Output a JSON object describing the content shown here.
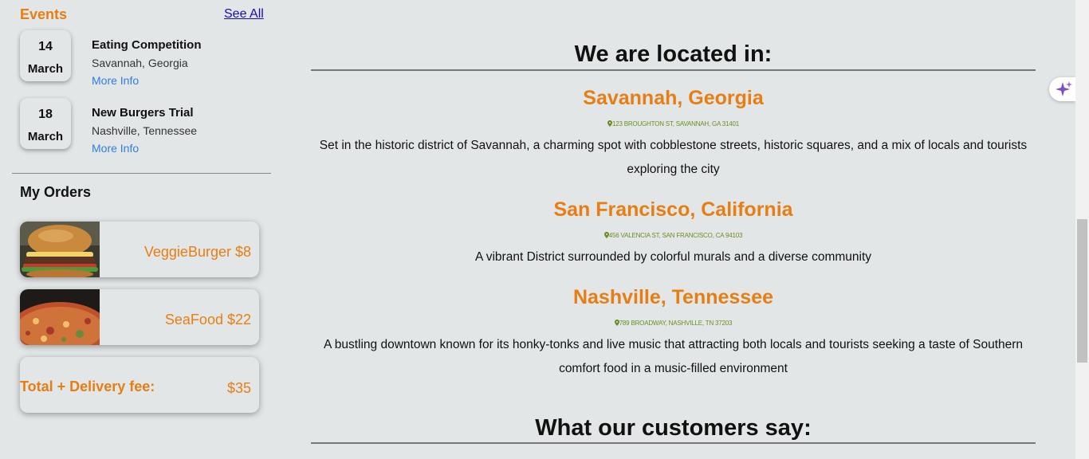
{
  "events": {
    "title": "Events",
    "see_all": "See All",
    "items": [
      {
        "day": "14",
        "month": "March",
        "name": "Eating Competition",
        "place": "Savannah, Georgia",
        "more": "More Info"
      },
      {
        "day": "18",
        "month": "March",
        "name": "New Burgers Trial",
        "place": "Nashville, Tennessee",
        "more": "More Info"
      }
    ]
  },
  "orders": {
    "title": "My Orders",
    "items": [
      {
        "label": "VeggieBurger $8",
        "image": "burger-photo"
      },
      {
        "label": "SeaFood $22",
        "image": "seafood-pizza-photo"
      }
    ],
    "total_label": "Total + Delivery fee:",
    "total_value": "$35"
  },
  "locations": {
    "heading": "We are located in:",
    "items": [
      {
        "name": "Savannah, Georgia",
        "address": "123 BROUGHTON ST, SAVANNAH, GA 31401",
        "desc": "Set in the historic district of Savannah, a charming spot with cobblestone streets, historic squares, and a mix of locals and tourists exploring the city"
      },
      {
        "name": "San Francisco, California",
        "address": "456 VALENCIA ST, SAN FRANCISCO, CA 94103",
        "desc": "A vibrant District surrounded by colorful murals and a diverse community"
      },
      {
        "name": "Nashville, Tennessee",
        "address": "789 BROADWAY, NASHVILLE, TN 37203",
        "desc": "A bustling downtown known for its honky-tonks and live music that attracting both locals and tourists seeking a taste of Southern comfort food in a music-filled environment"
      }
    ]
  },
  "testimonials": {
    "heading": "What our customers say:"
  },
  "colors": {
    "accent": "#e67e14",
    "link": "#2f7de1",
    "address": "#6b8e23",
    "background": "#e3e6e7"
  },
  "icons": {
    "address_marker": "map-pin-icon",
    "assistant": "sparkle-icon"
  }
}
